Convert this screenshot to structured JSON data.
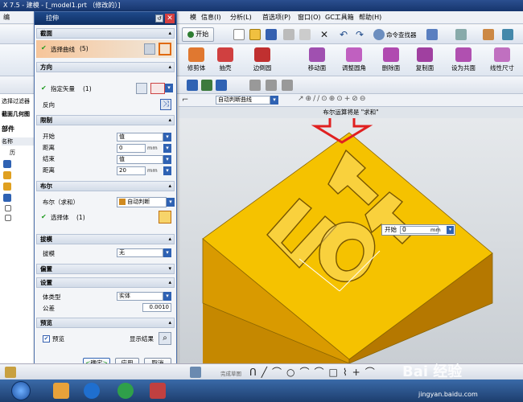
{
  "window": {
    "title": "X 7.5 - 建模 - [_model1.prt （修改的）]"
  },
  "menubar": {
    "items": [
      "编",
      "模",
      "信息(I)",
      "分析(L)",
      "首选项(P)",
      "窗口(O)",
      "GC工具箱",
      "帮助(H)"
    ]
  },
  "toolbar1": {
    "start_label": "开始",
    "command_finder_label": "命令查找器"
  },
  "toolbar2": {
    "buttons": [
      "修剪体",
      "抽壳",
      "边倒圆",
      "移动面",
      "调整圆角",
      "删除面",
      "复制面",
      "设为共面",
      "线性尺寸"
    ]
  },
  "left_panel": {
    "frag_plane": "平面",
    "filter_frag": "选择过滤器",
    "section_frag": "截面几何图",
    "parts_frag": "部件",
    "col_name": "名称",
    "history_frag": "历"
  },
  "dialog": {
    "title": "拉伸",
    "sections": {
      "section": "截面",
      "direction": "方向",
      "limits": "限制",
      "boolean": "布尔",
      "draft": "拔模",
      "offset": "偏置",
      "settings": "设置",
      "preview": "预览"
    },
    "select_curve": "选择曲线",
    "select_curve_count": "(5)",
    "specify_vector": "指定矢量",
    "specify_vector_count": "(1)",
    "reverse": "反向",
    "start_label": "开始",
    "start_value": "值",
    "start_distance_label": "距离",
    "start_distance": "0",
    "end_label": "结束",
    "end_value": "值",
    "end_distance_label": "距离",
    "end_distance": "20",
    "unit": "mm",
    "boolean_label": "布尔（求和）",
    "boolean_value": "自动判断",
    "select_body": "选择体",
    "select_body_count": "(1)",
    "draft_label": "拔模",
    "draft_value": "无",
    "body_type_label": "体类型",
    "body_type_value": "实体",
    "tolerance_label": "公差",
    "tolerance_value": "0.0010",
    "preview_label": "预览",
    "show_result": "显示结果",
    "ok": "确定",
    "apply": "应用",
    "cancel": "取消"
  },
  "selection_bar": {
    "filter_value": "自动判断曲线"
  },
  "cue_line": "布尔运算将是 \"求和\"",
  "viewport": {
    "handle_label": "开始",
    "handle_value": "0",
    "handle_unit": "mm"
  },
  "bottom_bar": {
    "curve_label": "完成草图"
  },
  "taskbar": {
    "watermark": "Bai 经验",
    "watermark_url": "jingyan.baidu.com"
  },
  "colors": {
    "block_top": "#f5c200",
    "block_side_left": "#d99a00",
    "block_side_right": "#b57800",
    "dialog_title": "#1f4a8a",
    "arrow_red": "#e02020"
  }
}
